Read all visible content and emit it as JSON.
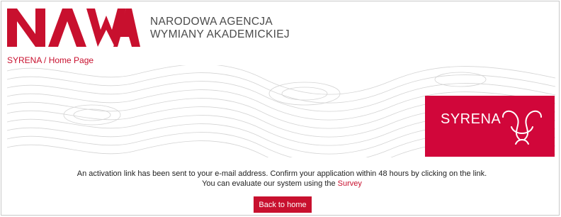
{
  "header": {
    "logo_text": "NAWA",
    "agency_line1": "NARODOWA AGENCJA",
    "agency_line2": "WYMIANY AKADEMICKIEJ"
  },
  "breadcrumb": {
    "root": "SYRENA",
    "separator": " / ",
    "current": "Home Page"
  },
  "banner": {
    "tile_text": "SYRENA",
    "icon": "syrena-wave-heart-icon"
  },
  "message": {
    "line1": "An activation link has been sent to your e-mail address. Confirm your application within 48 hours by clicking on the link.",
    "line2_prefix": "You can evaluate our system using the ",
    "survey_link": "Survey"
  },
  "actions": {
    "back_label": "Back to home"
  },
  "colors": {
    "brand_red": "#c8102e",
    "tile_red": "#d1063a",
    "text_gray": "#4b4b4b"
  }
}
